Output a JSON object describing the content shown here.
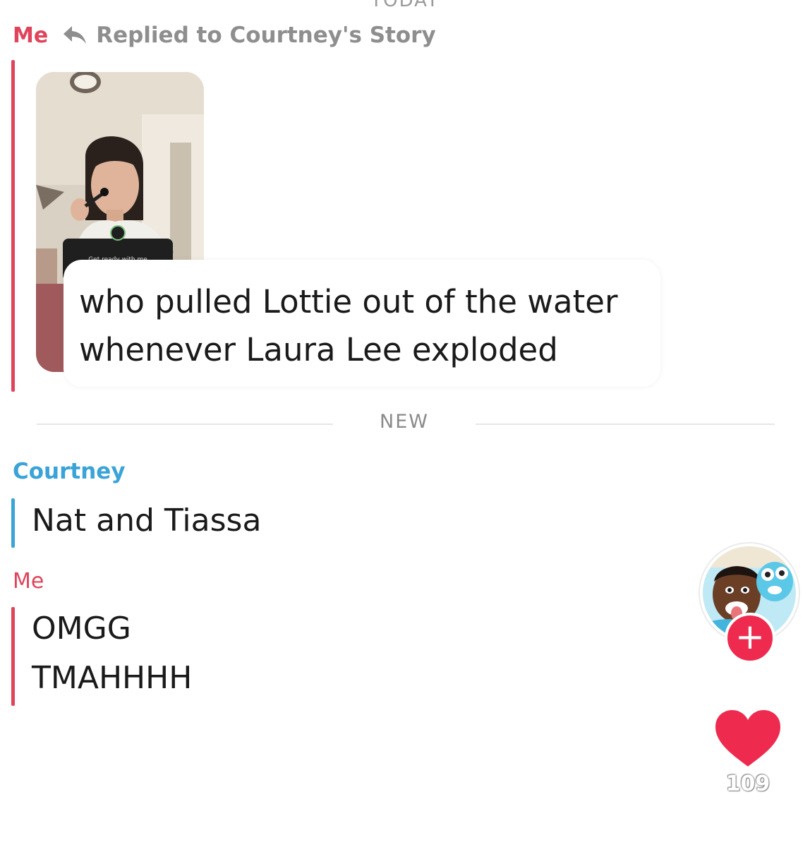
{
  "header": {
    "date_label": "TODAY"
  },
  "reply": {
    "sender": "Me",
    "reply_label": "Replied to Courtney's Story",
    "story_sticker_text": "Get ready with me",
    "message": "who pulled Lottie out of the water whenever Laura Lee exploded"
  },
  "divider_label": "NEW",
  "messages": [
    {
      "sender": "Courtney",
      "lines": [
        "Nat and Tiassa"
      ]
    },
    {
      "sender": "Me",
      "lines": [
        "OMGG",
        "TMAHHHH"
      ]
    }
  ],
  "sidebar": {
    "like_count": "109",
    "follow_symbol": "+"
  },
  "colors": {
    "me": "#e0445b",
    "friend": "#3aa3d8",
    "like": "#ee2b4f"
  },
  "icons": [
    "reply-arrow-icon",
    "heart-icon",
    "plus-icon"
  ]
}
